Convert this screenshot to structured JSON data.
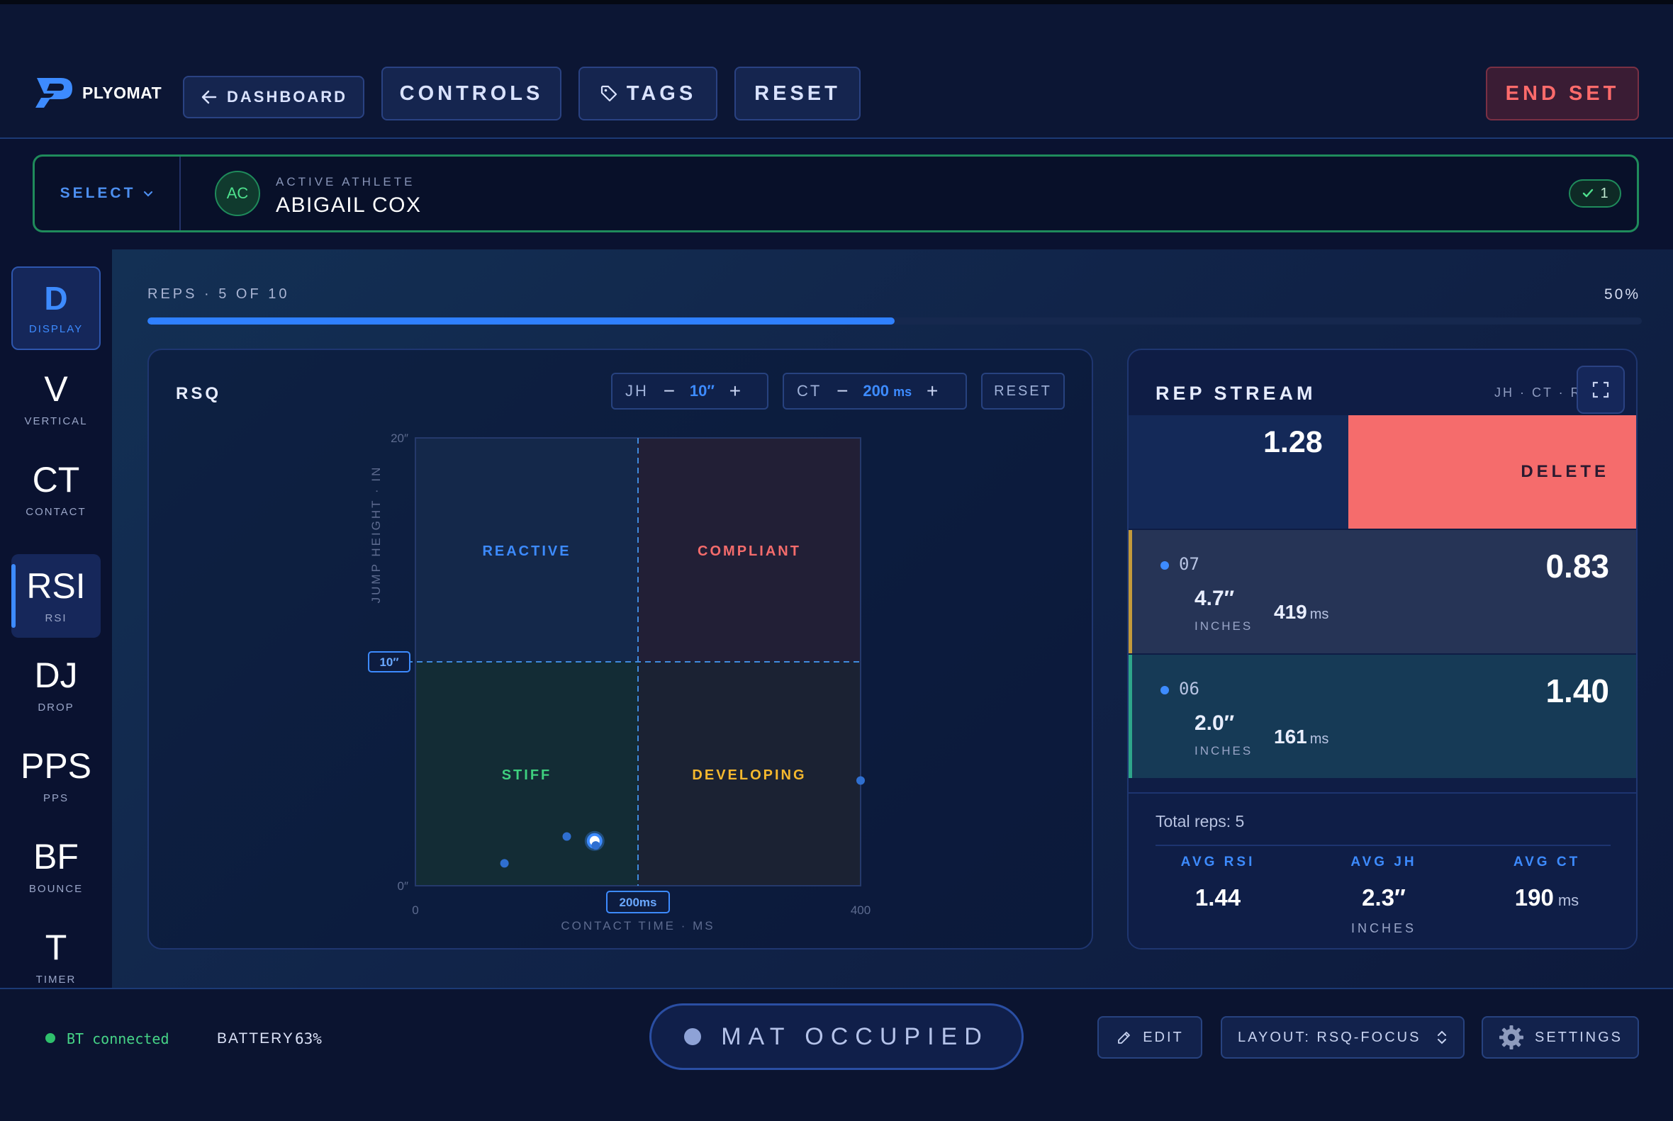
{
  "header": {
    "brand": "PLYOMAT",
    "dashboard_label": "DASHBOARD",
    "controls_label": "CONTROLS",
    "tags_label": "TAGS",
    "reset_label": "RESET",
    "end_set_label": "END SET"
  },
  "athlete": {
    "select_label": "SELECT",
    "initials": "AC",
    "kicker": "ACTIVE ATHLETE",
    "name": "ABIGAIL COX",
    "count": "1"
  },
  "sidebar": {
    "items": [
      {
        "big": "D",
        "small": "DISPLAY"
      },
      {
        "big": "V",
        "small": "VERTICAL"
      },
      {
        "big": "CT",
        "small": "CONTACT"
      },
      {
        "big": "RSI",
        "small": "RSI"
      },
      {
        "big": "DJ",
        "small": "DROP"
      },
      {
        "big": "PPS",
        "small": "PPS"
      },
      {
        "big": "BF",
        "small": "BOUNCE"
      },
      {
        "big": "T",
        "small": "TIMER"
      }
    ]
  },
  "progress": {
    "label": "REPS · 5 OF 10",
    "percent_label": "50%",
    "fraction": 0.5
  },
  "rsq": {
    "title": "RSQ",
    "jh_label": "JH",
    "jh_value": "10″",
    "ct_label": "CT",
    "ct_value": "200",
    "ct_unit": "ms",
    "reset_label": "RESET",
    "minus": "−",
    "plus": "+"
  },
  "chart_data": {
    "type": "scatter",
    "title": "RSQ",
    "xlabel": "CONTACT TIME · MS",
    "ylabel": "JUMP HEIGHT · IN",
    "xlim": [
      0,
      400
    ],
    "ylim": [
      0,
      20
    ],
    "x_tick_labels": [
      "0",
      "400"
    ],
    "y_tick_labels": [
      "0″",
      "20″"
    ],
    "thresholds": {
      "x": 200,
      "y": 10,
      "x_label": "200ms",
      "y_label": "10″"
    },
    "quadrants": [
      {
        "name": "REACTIVE",
        "color": "#3d8bff"
      },
      {
        "name": "COMPLIANT",
        "color": "#f56c6c"
      },
      {
        "name": "STIFF",
        "color": "#3ecf7e"
      },
      {
        "name": "DEVELOPING",
        "color": "#f5b82e"
      }
    ],
    "points": [
      {
        "x": 161,
        "y": 2.0,
        "latest": true
      },
      {
        "x": 162,
        "y": 1.8
      },
      {
        "x": 136,
        "y": 2.2
      },
      {
        "x": 80,
        "y": 1.0
      },
      {
        "x": 400,
        "y": 4.7
      }
    ]
  },
  "stream": {
    "title": "REP STREAM",
    "tabs": "JH · CT · RSI",
    "swipe_value": "1.28",
    "delete_label": "DELETE",
    "reps": [
      {
        "num": "07",
        "rsi": "0.83",
        "jh": "4.7″",
        "jh_unit": "INCHES",
        "ct": "419",
        "ct_unit": "ms"
      },
      {
        "num": "06",
        "rsi": "1.40",
        "jh": "2.0″",
        "jh_unit": "INCHES",
        "ct": "161",
        "ct_unit": "ms"
      }
    ],
    "total_reps": "Total reps: 5",
    "avg": {
      "rsi_label": "AVG RSI",
      "rsi_value": "1.44",
      "jh_label": "AVG JH",
      "jh_value": "2.3″",
      "jh_unit": "INCHES",
      "ct_label": "AVG CT",
      "ct_value": "190",
      "ct_unit": "ms"
    }
  },
  "footer": {
    "bt_status": "BT connected",
    "battery_label": "BATTERY",
    "battery_value": "63%",
    "mat_status": "MAT OCCUPIED",
    "edit_label": "EDIT",
    "layout_label": "LAYOUT: RSQ-FOCUS",
    "settings_label": "SETTINGS"
  },
  "colors": {
    "accent": "#3d8bff",
    "success": "#2fc06c",
    "danger": "#f56c6c",
    "warning": "#f5b82e"
  }
}
